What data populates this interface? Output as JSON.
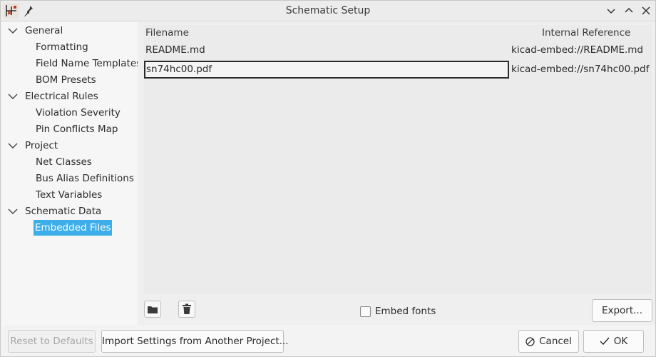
{
  "window": {
    "title": "Schematic Setup"
  },
  "tree": {
    "categories": [
      {
        "label": "General",
        "children": [
          "Formatting",
          "Field Name Templates",
          "BOM Presets"
        ]
      },
      {
        "label": "Electrical Rules",
        "children": [
          "Violation Severity",
          "Pin Conflicts Map"
        ]
      },
      {
        "label": "Project",
        "children": [
          "Net Classes",
          "Bus Alias Definitions",
          "Text Variables"
        ]
      },
      {
        "label": "Schematic Data",
        "children": [
          "Embedded Files"
        ]
      }
    ],
    "selected": "Embedded Files"
  },
  "table": {
    "headers": {
      "filename": "Filename",
      "reference": "Internal Reference"
    },
    "rows": [
      {
        "filename": "README.md",
        "reference": "kicad-embed://README.md"
      },
      {
        "filename": "sn74hc00.pdf",
        "reference": "kicad-embed://sn74hc00.pdf"
      }
    ]
  },
  "toolbar": {
    "add_icon": "folder-icon",
    "delete_icon": "trash-icon",
    "embed_fonts_label": "Embed fonts",
    "embed_fonts_checked": false,
    "export_label": "Export..."
  },
  "footer": {
    "reset_label": "Reset to Defaults",
    "import_label": "Import Settings from Another Project...",
    "cancel_label": "Cancel",
    "ok_label": "OK"
  },
  "colors": {
    "selection": "#3daee9"
  }
}
